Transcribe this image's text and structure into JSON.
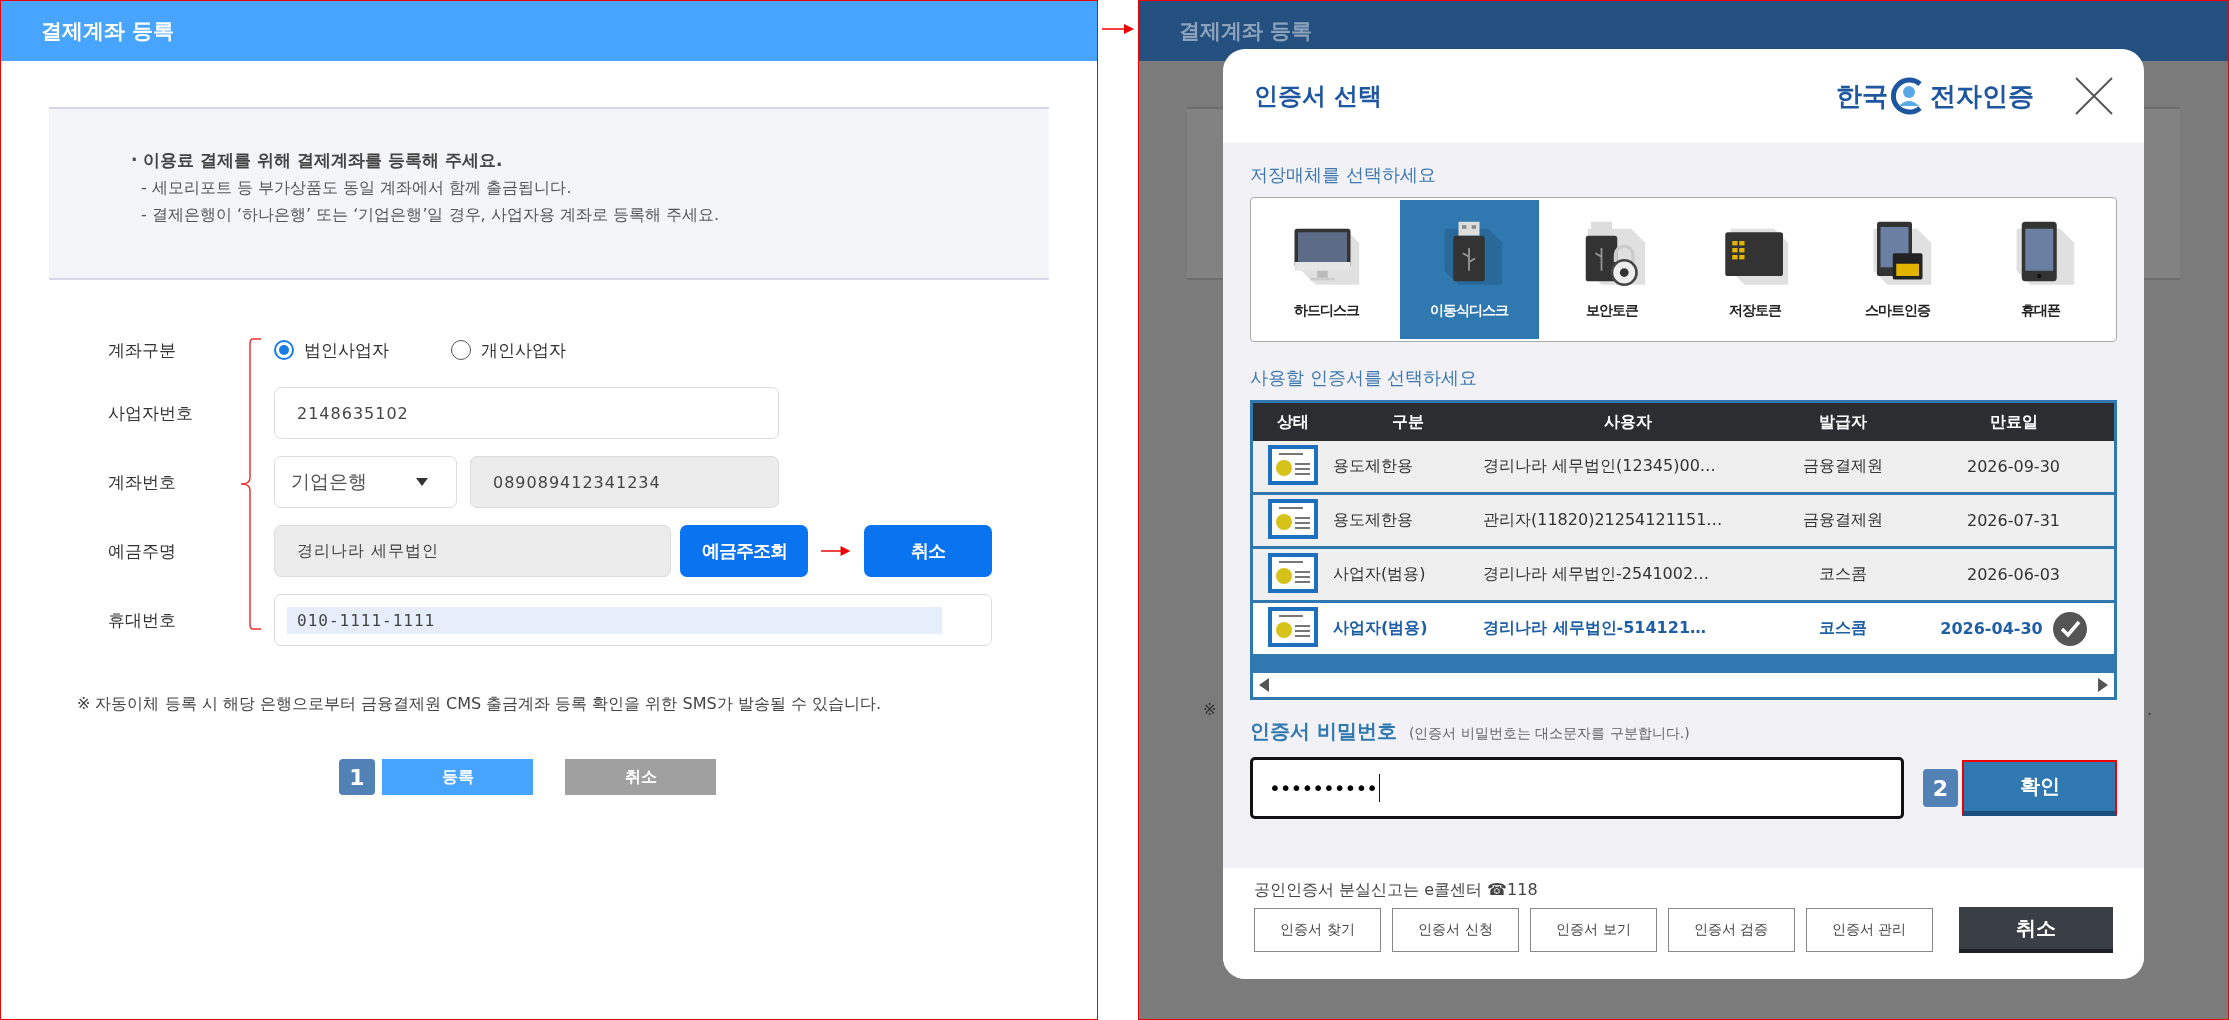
{
  "left_panel": {
    "title": "결제계좌 등록",
    "notice": {
      "headline": "· 이용료 결제를 위해 결제계좌를 등록해 주세요.",
      "lines": [
        "- 세모리포트 등 부가상품도 동일 계좌에서 함께 출금됩니다.",
        "- 결제은행이 ‘하나은행’ 또는 ‘기업은행’일 경우, 사업자용 계좌로 등록해 주세요."
      ]
    },
    "form": {
      "account_type": {
        "label": "계좌구분",
        "options": [
          {
            "label": "법인사업자",
            "selected": true
          },
          {
            "label": "개인사업자",
            "selected": false
          }
        ]
      },
      "business_number": {
        "label": "사업자번호",
        "value": "2148635102"
      },
      "account_number": {
        "label": "계좌번호",
        "bank": "기업은행",
        "value": "089089412341234"
      },
      "holder": {
        "label": "예금주명",
        "value": "경리나라 세무법인",
        "lookup_button": "예금주조회",
        "cancel_button": "취소"
      },
      "phone": {
        "label": "휴대번호",
        "value": "010-1111-1111"
      }
    },
    "note": "※ 자동이체 등록 시 해당 은행으로부터 금융결제원 CMS 출금계좌 등록 확인을 위한 SMS가 발송될 수 있습니다.",
    "step_badge": "1",
    "buttons": [
      {
        "label": "등록",
        "kind": "primary"
      },
      {
        "label": "취소",
        "kind": "secondary"
      }
    ]
  },
  "right_panel": {
    "background_title": "결제계좌 등록",
    "background_note_start": "※",
    "background_note_end": ".",
    "dialog": {
      "title": "인증서 선택",
      "logo_left": "한국",
      "logo_right": "전자인증",
      "media_label": "저장매체를 선택하세요",
      "media": [
        {
          "label": "하드디스크",
          "kind": "monitor",
          "selected": false
        },
        {
          "label": "이동식디스크",
          "kind": "usb",
          "selected": true
        },
        {
          "label": "보안토큰",
          "kind": "token",
          "selected": false
        },
        {
          "label": "저장토큰",
          "kind": "card",
          "selected": false
        },
        {
          "label": "스마트인증",
          "kind": "usim",
          "selected": false
        },
        {
          "label": "휴대폰",
          "kind": "phone",
          "selected": false
        }
      ],
      "cert_label": "사용할 인증서를 선택하세요",
      "table": {
        "columns": [
          "상태",
          "구분",
          "사용자",
          "발급자",
          "만료일"
        ],
        "rows": [
          {
            "type": "용도제한용",
            "user": "경리나라 세무법인(12345)00…",
            "issuer": "금융결제원",
            "expiry": "2026-09-30",
            "selected": false
          },
          {
            "type": "용도제한용",
            "user": "관리자(11820)21254121151…",
            "issuer": "금융결제원",
            "expiry": "2026-07-31",
            "selected": false
          },
          {
            "type": "사업자(범용)",
            "user": "경리나라 세무법인-2541002…",
            "issuer": "코스콤",
            "expiry": "2026-06-03",
            "selected": false
          },
          {
            "type": "사업자(범용)",
            "user": "경리나라 세무법인-514121…",
            "issuer": "코스콤",
            "expiry": "2026-04-30",
            "selected": true
          }
        ]
      },
      "password": {
        "label": "인증서 비밀번호",
        "hint": "(인증서 비밀번호는 대소문자를 구분합니다.)",
        "value": "••••••••••"
      },
      "step_badge": "2",
      "confirm_button": "확인",
      "footer": {
        "text": "공인인증서 분실신고는 e콜센터 ☎118",
        "buttons": [
          "인증서 찾기",
          "인증서 신청",
          "인증서 보기",
          "인증서 검증",
          "인증서 관리"
        ],
        "cancel_button": "취소"
      }
    }
  }
}
